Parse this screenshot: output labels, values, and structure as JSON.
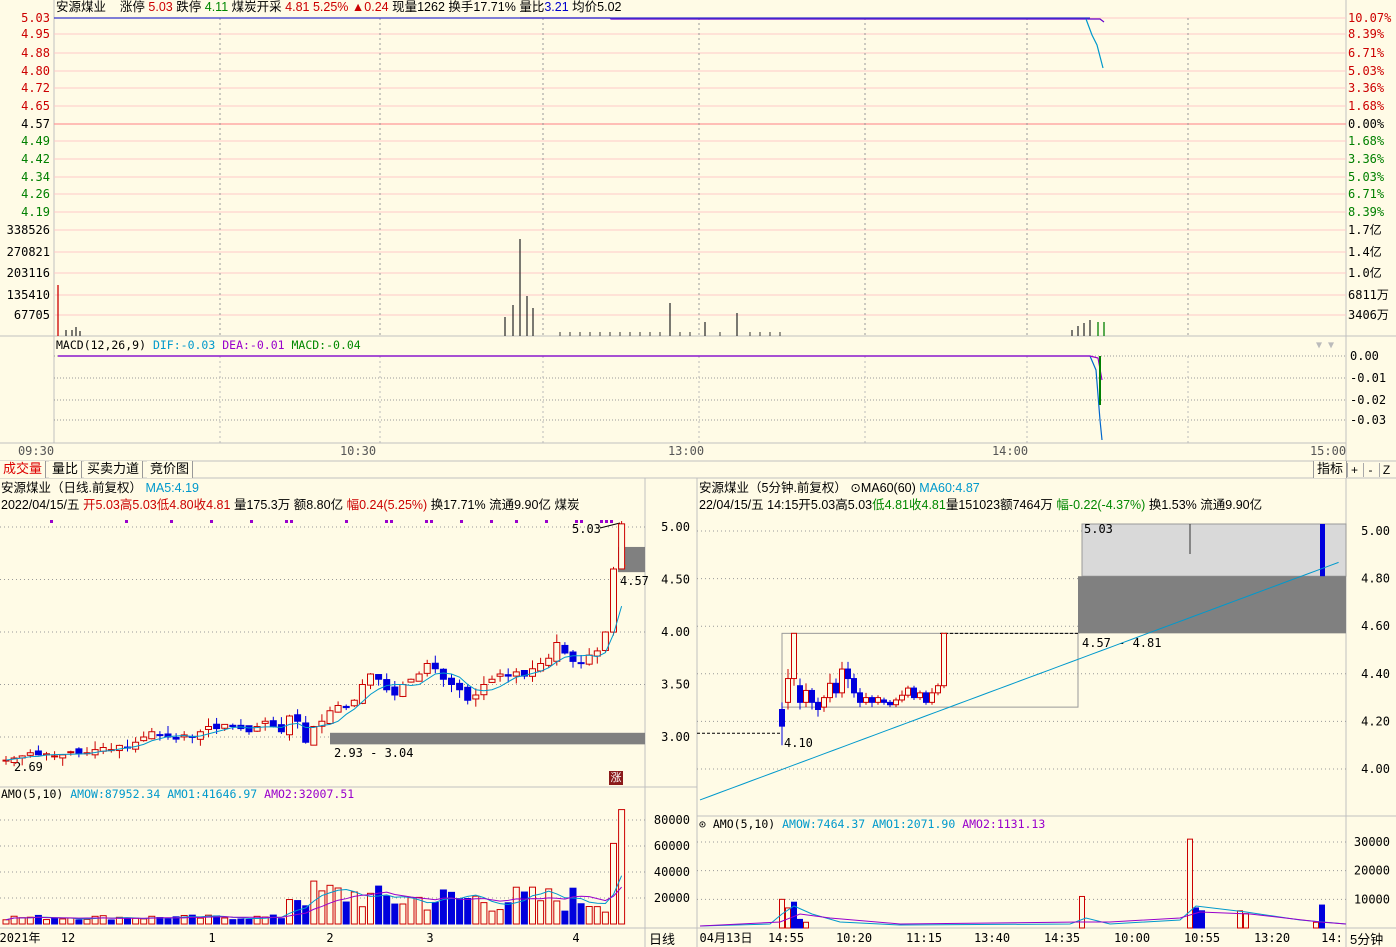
{
  "colors": {
    "up": "#cc0000",
    "down": "#0000dd",
    "flat": "#008000",
    "cyan": "#0099cc",
    "purple": "#9900cc",
    "gray": "#808080",
    "light_gray": "#d9d9d9",
    "bg": "#fffbe6"
  },
  "intraday": {
    "name": "安源煤业",
    "limit_up_label": "涨停",
    "limit_up": "5.03",
    "limit_down_label": "跌停",
    "limit_down": "4.11",
    "sector": "煤炭开采",
    "price": "4.81",
    "pct": "5.25%",
    "change": "▲0.24",
    "volume_label": "现量",
    "volume": "1262",
    "turnover_label": "换手",
    "turnover": "17.71%",
    "vol_ratio_label": "量比",
    "vol_ratio": "3.21",
    "avg_label": "均价",
    "avg": "5.02",
    "price_axis": [
      "5.03",
      "4.95",
      "4.88",
      "4.80",
      "4.72",
      "4.65",
      "4.57",
      "4.49",
      "4.42",
      "4.34",
      "4.26",
      "4.19"
    ],
    "pct_axis": [
      "10.07%",
      "8.39%",
      "6.71%",
      "5.03%",
      "3.36%",
      "1.68%",
      "0.00%",
      "1.68%",
      "3.36%",
      "5.03%",
      "6.71%",
      "8.39%"
    ],
    "vol_axis_left": [
      "338526",
      "270821",
      "203116",
      "135410",
      "67705"
    ],
    "vol_axis_right": [
      "1.7亿",
      "1.4亿",
      "1.0亿",
      "6811万",
      "3406万"
    ],
    "macd_legend": {
      "name": "MACD(12,26,9)",
      "dif_label": "DIF:",
      "dif": "-0.03",
      "dea_label": "DEA:",
      "dea": "-0.01",
      "macd_label": "MACD:",
      "macd": "-0.04"
    },
    "macd_axis": [
      "0.00",
      "-0.01",
      "-0.02",
      "-0.03"
    ],
    "time_axis": [
      "09:30",
      "10:30",
      "13:00",
      "14:00",
      "15:00"
    ]
  },
  "tabs": [
    "成交量",
    "量比",
    "买卖力道",
    "竞价图"
  ],
  "toolbar": {
    "indicator": "指标",
    "plus": "+",
    "minus": "-",
    "z": "Z"
  },
  "daily": {
    "title": "安源煤业（日线.前复权）",
    "ma_label": "MA5:",
    "ma_value": "4.19",
    "date": "2022/04/15/五",
    "open_label": "开",
    "open": "5.03",
    "high_label": "高",
    "high": "5.03",
    "low_label": "低",
    "low": "4.80",
    "close_label": "收",
    "close": "4.81",
    "vol_label": "量",
    "vol": "175.3万",
    "amt_label": "额",
    "amt": "8.80亿",
    "range_label": "幅",
    "range": "0.24(5.25%)",
    "turn_label": "换",
    "turn": "17.71%",
    "float_label": "流通",
    "float": "9.90亿",
    "sector": "煤炭",
    "price_axis": [
      "5.00",
      "4.50",
      "4.00",
      "3.50",
      "3.00"
    ],
    "high_mark": "5.03",
    "low_mark": "2.69",
    "zone_upper_label": "4.57",
    "zone_lower_label": "2.93 - 3.04",
    "limit_badge": "涨",
    "amo_legend": {
      "name": "AMO(5,10)",
      "w_label": "AMOW:",
      "w": "87952.34",
      "a1_label": "AMO1:",
      "a1": "41646.97",
      "a2_label": "AMO2:",
      "a2": "32007.51"
    },
    "amo_axis": [
      "80000",
      "60000",
      "40000",
      "20000"
    ],
    "date_axis": [
      "2021年",
      "12",
      "1",
      "2",
      "3",
      "4"
    ],
    "period": "日线"
  },
  "min5": {
    "title": "安源煤业（5分钟.前复权）",
    "ma_label": "MA60(60)",
    "ma_key": "MA60:",
    "ma_value": "4.87",
    "date": "22/04/15/五",
    "time": "14:15",
    "open_label": "开",
    "open": "5.03",
    "high_label": "高",
    "high": "5.03",
    "low_label": "低",
    "low": "4.81",
    "close_label": "收",
    "close": "4.81",
    "vol_label": "量",
    "vol": "151023",
    "amt_label": "额",
    "amt": "7464万",
    "range_label": "幅",
    "range": "-0.22(-4.37%)",
    "turn_label": "换",
    "turn": "1.53%",
    "float_label": "流通",
    "float": "9.90亿",
    "price_axis": [
      "5.00",
      "4.80",
      "4.60",
      "4.40",
      "4.20",
      "4.00"
    ],
    "high_mark": "5.03",
    "low_mark": "4.10",
    "range_mark": "4.57 - 4.81",
    "amo_legend": {
      "name": "AMO(5,10)",
      "w_label": "AMOW:",
      "w": "7464.37",
      "a1_label": "AMO1:",
      "a1": "2071.90",
      "a2_label": "AMO2:",
      "a2": "1131.13"
    },
    "amo_axis": [
      "30000",
      "20000",
      "10000"
    ],
    "time_axis": [
      "04月13日",
      "14:55",
      "10:20",
      "11:15",
      "13:40",
      "14:35",
      "10:00",
      "10:55",
      "13:20",
      "14:"
    ],
    "period": "5分钟"
  }
}
